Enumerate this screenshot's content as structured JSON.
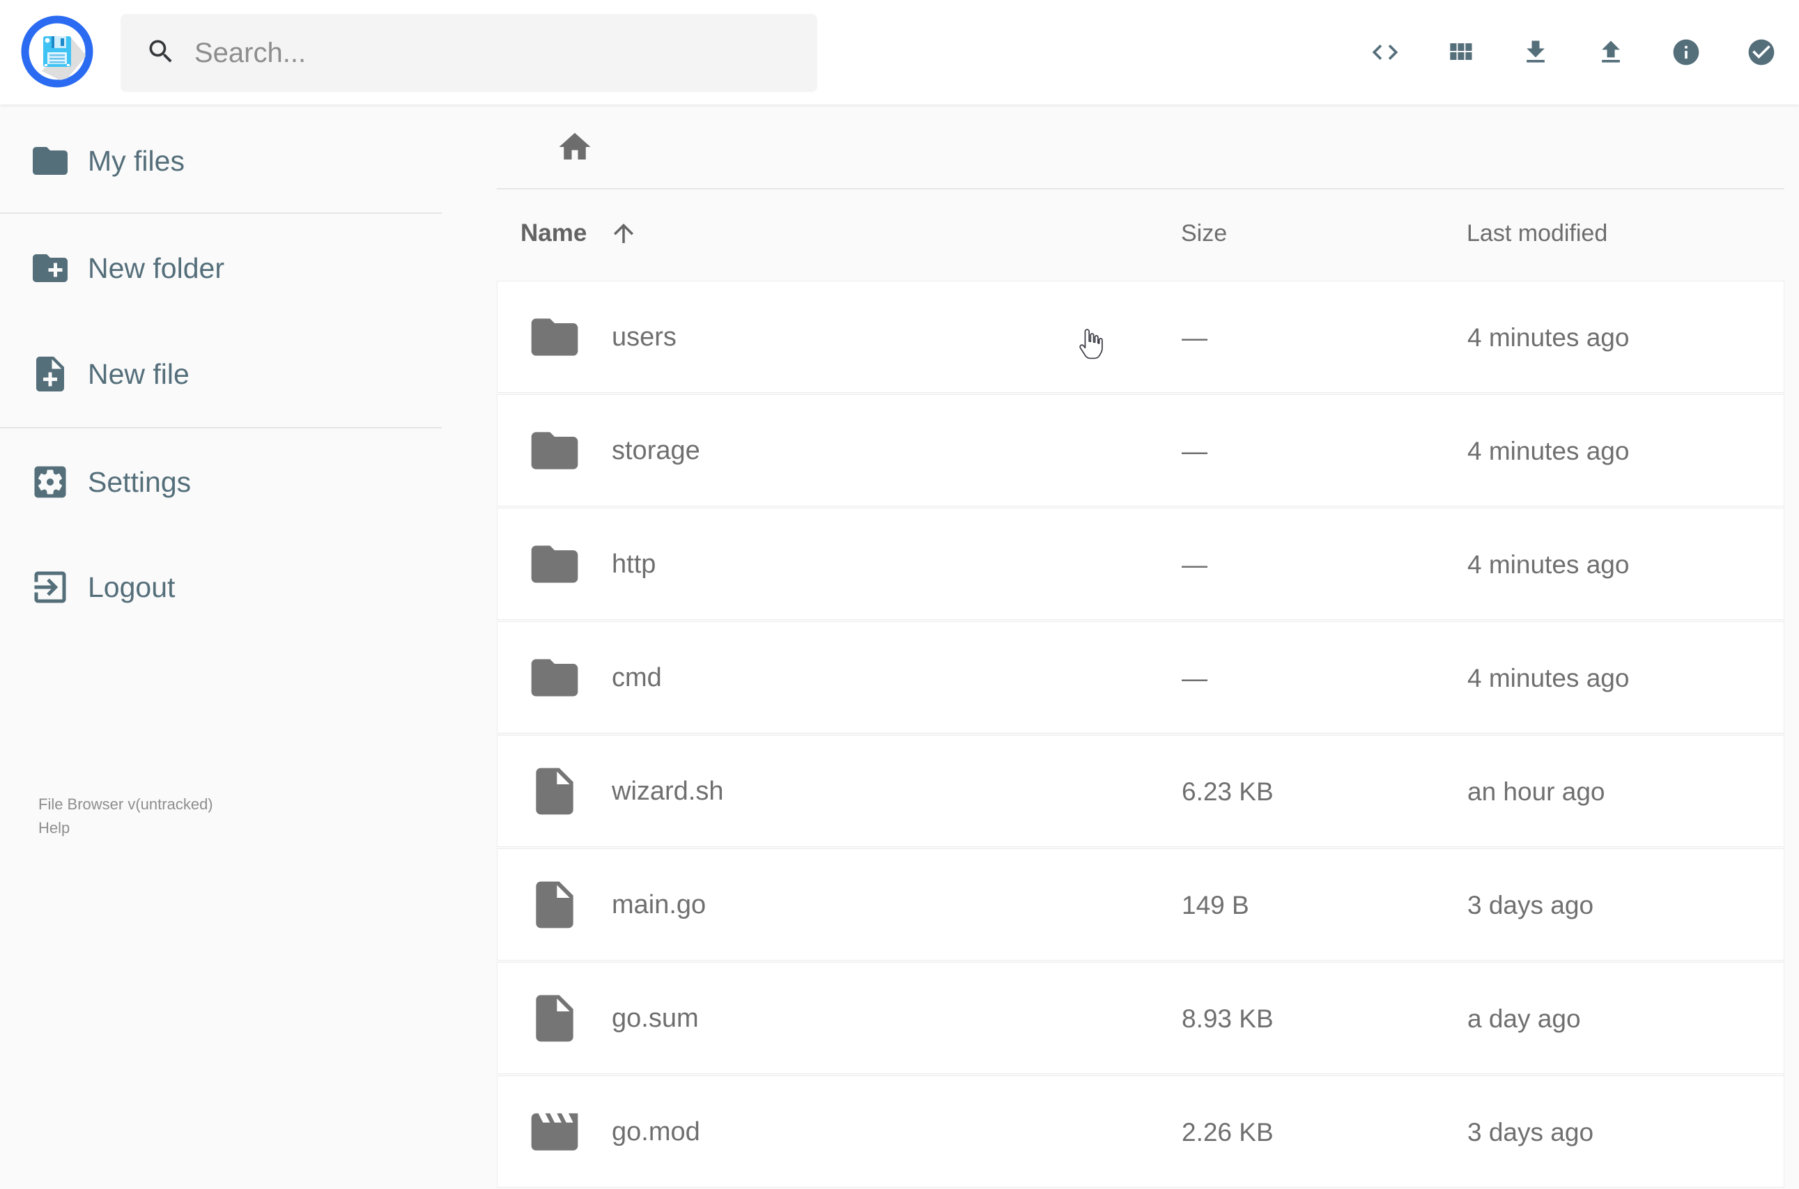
{
  "topbar": {
    "search_placeholder": "Search...",
    "icons": [
      "shell-icon",
      "grid-view-icon",
      "download-icon",
      "upload-icon",
      "info-icon",
      "select-multiple-icon"
    ]
  },
  "sidebar": {
    "items": [
      {
        "icon": "folder-icon",
        "label": "My files"
      },
      {
        "icon": "new-folder-icon",
        "label": "New folder"
      },
      {
        "icon": "new-file-icon",
        "label": "New file"
      },
      {
        "icon": "settings-icon",
        "label": "Settings"
      },
      {
        "icon": "logout-icon",
        "label": "Logout"
      }
    ],
    "footer": {
      "version": "File Browser v(untracked)",
      "help": "Help"
    }
  },
  "breadcrumb": {
    "home": "home-icon"
  },
  "listing": {
    "columns": {
      "name": "Name",
      "size": "Size",
      "modified": "Last modified"
    },
    "sort": {
      "column": "Name",
      "direction": "asc"
    },
    "rows": [
      {
        "icon": "folder",
        "name": "users",
        "size": "—",
        "modified": "4 minutes ago"
      },
      {
        "icon": "folder",
        "name": "storage",
        "size": "—",
        "modified": "4 minutes ago"
      },
      {
        "icon": "folder",
        "name": "http",
        "size": "—",
        "modified": "4 minutes ago"
      },
      {
        "icon": "folder",
        "name": "cmd",
        "size": "—",
        "modified": "4 minutes ago"
      },
      {
        "icon": "file",
        "name": "wizard.sh",
        "size": "6.23 KB",
        "modified": "an hour ago"
      },
      {
        "icon": "file",
        "name": "main.go",
        "size": "149 B",
        "modified": "3 days ago"
      },
      {
        "icon": "file",
        "name": "go.sum",
        "size": "8.93 KB",
        "modified": "a day ago"
      },
      {
        "icon": "movie",
        "name": "go.mod",
        "size": "2.26 KB",
        "modified": "3 days ago"
      }
    ]
  },
  "colors": {
    "accent_slate": "#546e7a",
    "row_icon_gray": "#757575",
    "text_gray": "#6f6f6f",
    "logo_ring_blue": "#2a6bf2",
    "logo_floppy_blue": "#3fc3f5",
    "background": "#fafafa"
  }
}
